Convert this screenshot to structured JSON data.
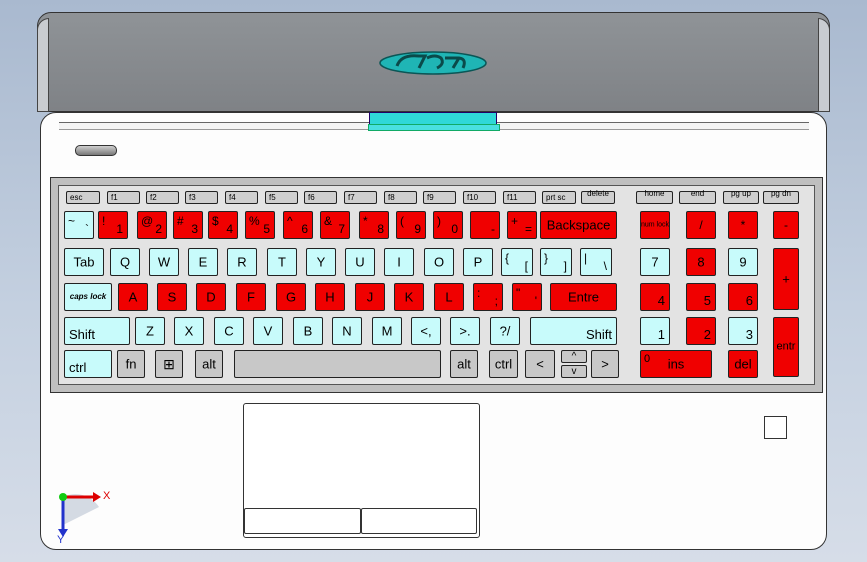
{
  "lid": {
    "logo": "logo"
  },
  "keys": {
    "fn_row": [
      "esc",
      "f1",
      "f2",
      "f3",
      "f4",
      "f5",
      "f6",
      "f7",
      "f8",
      "f9",
      "f10",
      "f11",
      "prt sc",
      "delete",
      "home",
      "end",
      "pg up",
      "pg dn"
    ],
    "num_row": [
      {
        "t": "~",
        "b": "`"
      },
      {
        "t": "!",
        "b": "1"
      },
      {
        "t": "@",
        "b": "2"
      },
      {
        "t": "#",
        "b": "3"
      },
      {
        "t": "$",
        "b": "4"
      },
      {
        "t": "%",
        "b": "5"
      },
      {
        "t": "^",
        "b": "6"
      },
      {
        "t": "&",
        "b": "7"
      },
      {
        "t": "*",
        "b": "8"
      },
      {
        "t": "(",
        "b": "9"
      },
      {
        "t": ")",
        "b": "0"
      },
      {
        "t": "",
        "b": "-"
      },
      {
        "t": "+",
        "b": "="
      }
    ],
    "backspace": "Backspace",
    "tab": "Tab",
    "qrow": [
      "Q",
      "W",
      "E",
      "R",
      "T",
      "Y",
      "U",
      "I",
      "O",
      "P"
    ],
    "brackets": [
      {
        "t": "{",
        "b": "["
      },
      {
        "t": "}",
        "b": "]"
      },
      {
        "t": "|",
        "b": "\\"
      }
    ],
    "caps": "caps lock",
    "arow": [
      "A",
      "S",
      "D",
      "F",
      "G",
      "H",
      "J",
      "K",
      "L"
    ],
    "semi": [
      {
        "t": ":",
        "b": ";"
      },
      {
        "t": "\"",
        "b": "'"
      }
    ],
    "enter": "Entre",
    "shift_l": "Shift",
    "zrow": [
      "Z",
      "X",
      "C",
      "V",
      "B",
      "N",
      "M",
      "<,",
      ">.",
      "?/"
    ],
    "shift_r": "Shift",
    "ctrl_l": "ctrl",
    "fnkey": "fn",
    "win": "⊞",
    "alt_l": "alt",
    "alt_r": "alt",
    "ctrl_r": "ctrl",
    "arrow_left": "<",
    "arrow_up": "^",
    "arrow_down": "v",
    "arrow_right": ">",
    "numpad": {
      "numlock": "num lock",
      "slash": "/",
      "star": "*",
      "minus": "-",
      "n7": "7",
      "n8": "8",
      "n9": "9",
      "plus": "+",
      "n4": "4",
      "n5": "5",
      "n6": "6",
      "n1": "1",
      "n2": "2",
      "n3": "3",
      "enter": "entr",
      "n0": "0",
      "ins": "ins",
      "del": "del"
    }
  },
  "axes": {
    "x": "X",
    "y": "Y"
  }
}
